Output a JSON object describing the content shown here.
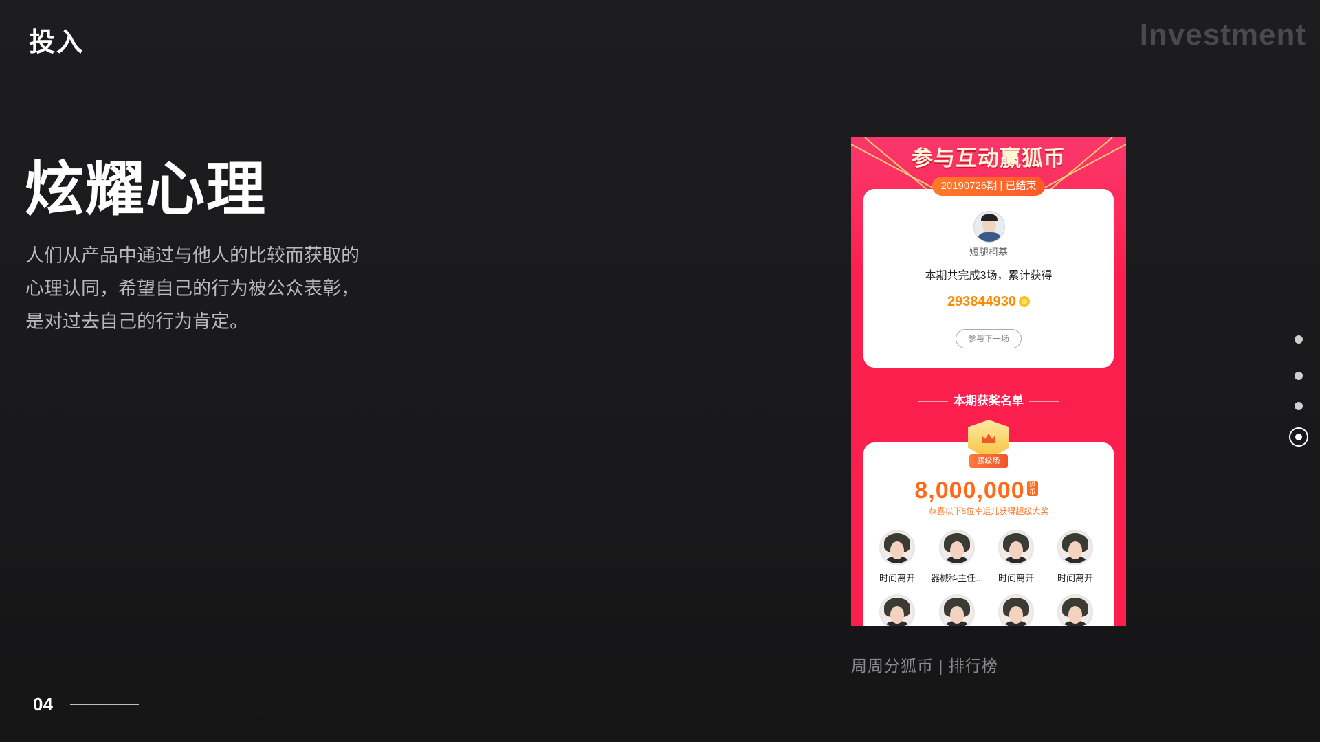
{
  "section_label": "投入",
  "section_label_en": "Investment",
  "headline": "炫耀心理",
  "body_lines": [
    "人们从产品中通过与他人的比较而获取的",
    "心理认同，希望自己的行为被公众表彰，",
    "是对过去自己的行为肯定。"
  ],
  "phone": {
    "banner_title": "参与互动赢狐币",
    "period_label": "20190726期 | 已结束",
    "user_name": "短腿柯基",
    "summary": "本期共完成3场，累计获得",
    "score": "293844930",
    "next_button": "参与下一场",
    "winners_title": "本期获奖名单",
    "tier_badge": "顶级场",
    "prize_amount": "8,000,000",
    "prize_unit": "狐币",
    "prize_caption": "恭喜以下8位幸运儿获得超级大奖",
    "winners": [
      {
        "name": "时间离开"
      },
      {
        "name": "器械科主任..."
      },
      {
        "name": "时间离开"
      },
      {
        "name": "时间离开"
      },
      {
        "name": ""
      },
      {
        "name": ""
      },
      {
        "name": ""
      },
      {
        "name": ""
      }
    ]
  },
  "caption": "周周分狐币 | 排行榜",
  "page_number": "04",
  "nav_dots": {
    "count": 4,
    "active_index": 3
  },
  "colors": {
    "background": "#1a1a1c",
    "phone_red": "#fb1f4e",
    "accent_orange": "#ff6a1a",
    "score_orange": "#ff8a00"
  }
}
